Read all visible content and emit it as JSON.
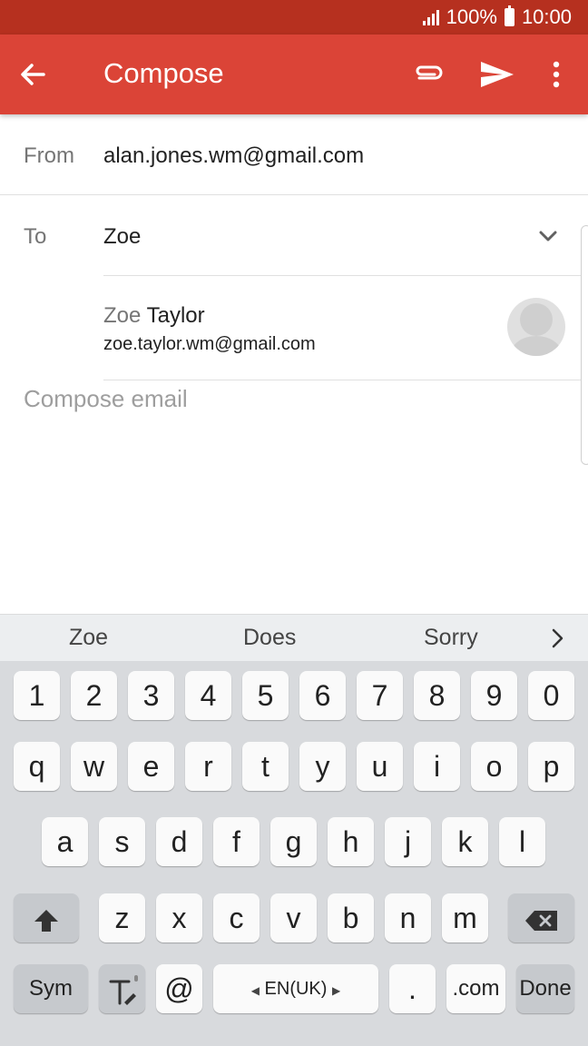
{
  "status_bar": {
    "battery": "100%",
    "time": "10:00"
  },
  "app_bar": {
    "title": "Compose"
  },
  "icons": {
    "back": "arrow-left-icon",
    "attach": "paperclip-icon",
    "send": "send-icon",
    "more": "more-vert-icon",
    "expand": "chevron-down-icon",
    "avatar": "person-avatar-icon"
  },
  "colors": {
    "status_bar": "#b6301f",
    "app_bar": "#db4437"
  },
  "form": {
    "from_label": "From",
    "from_value": "alan.jones.wm@gmail.com",
    "to_label": "To",
    "to_value": "Zoe",
    "suggestion": {
      "name_match": "Zoe",
      "name_rest": " Taylor",
      "email": "zoe.taylor.wm@gmail.com"
    },
    "body_placeholder": "Compose email"
  },
  "keyboard": {
    "suggestions": [
      "Zoe",
      "Does",
      "Sorry"
    ],
    "row_numbers": [
      "1",
      "2",
      "3",
      "4",
      "5",
      "6",
      "7",
      "8",
      "9",
      "0"
    ],
    "row_q": [
      "q",
      "w",
      "e",
      "r",
      "t",
      "y",
      "u",
      "i",
      "o",
      "p"
    ],
    "row_a": [
      "a",
      "s",
      "d",
      "f",
      "g",
      "h",
      "j",
      "k",
      "l"
    ],
    "row_z": [
      "z",
      "x",
      "c",
      "v",
      "b",
      "n",
      "m"
    ],
    "sym": "Sym",
    "at": "@",
    "space": "EN(UK)",
    "period": ".",
    "dotcom": ".com",
    "done": "Done"
  }
}
